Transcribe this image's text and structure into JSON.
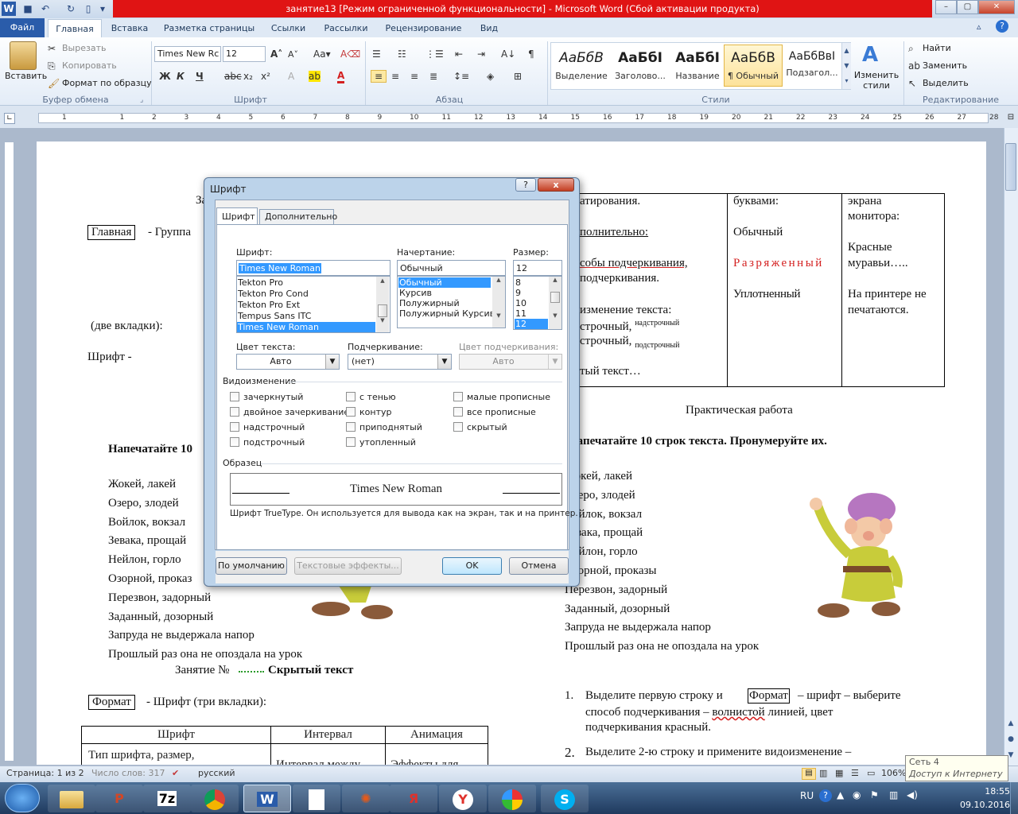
{
  "title": "занятие13 [Режим ограниченной функциональности]  -  Microsoft Word (Сбой активации продукта)",
  "tabs": [
    "Файл",
    "Главная",
    "Вставка",
    "Разметка страницы",
    "Ссылки",
    "Рассылки",
    "Рецензирование",
    "Вид"
  ],
  "clipboard": {
    "paste": "Вставить",
    "cut": "Вырезать",
    "copy": "Копировать",
    "format_painter": "Формат по образцу",
    "label": "Буфер обмена"
  },
  "font_group": {
    "font": "Times New Rc",
    "size": "12",
    "label": "Шрифт"
  },
  "paragraph_label": "Абзац",
  "styles": {
    "items": [
      {
        "sample": "АаБбВ",
        "name": "Выделение"
      },
      {
        "sample": "АаБбI",
        "name": "Заголово..."
      },
      {
        "sample": "АаБбI",
        "name": "Название"
      },
      {
        "sample": "АаБбВ",
        "name": "¶ Обычный"
      },
      {
        "sample": "АаБбВвI",
        "name": "Подзагол..."
      }
    ],
    "change": "Изменить стили",
    "label": "Стили"
  },
  "editing": {
    "find": "Найти",
    "replace": "Заменить",
    "select": "Выделить",
    "label": "Редактирование"
  },
  "ruler_nums": [
    "1",
    "1",
    "2",
    "3",
    "4",
    "5",
    "6",
    "7",
    "8",
    "9",
    "10",
    "11",
    "12",
    "13",
    "14",
    "15",
    "16",
    "17",
    "18",
    "19",
    "20",
    "21",
    "22",
    "23",
    "24",
    "25",
    "26",
    "27",
    "28"
  ],
  "doc": {
    "left_top": "За",
    "glavnaya": "Главная",
    "gruppa": "-  Группа",
    "dve_vkladki": "(две вкладки):",
    "shrift": "Шрифт   -",
    "napechataite_left": "Напечатайте  10",
    "left_lines": [
      "Жокей, лакей",
      "Озеро, злодей",
      "Войлок, вокзал",
      "Зевака, прощай",
      "Нейлон, горло",
      "Озорной, проказ",
      "Перезвон, задорный",
      "Заданный, дозорный",
      "Запруда не выдержала напор",
      "Прошлый раз она не опоздала на урок"
    ],
    "zanyatie": "Занятие №",
    "skryty": "Скрытый текст",
    "format": "Формат",
    "format_rest": "-  Шрифт (три вкладки):",
    "bottom_table": {
      "headers": [
        "Шрифт",
        "Интервал",
        "Анимация"
      ],
      "row1": [
        "Тип шрифта, размер,",
        "Интервал между",
        "Эффекты для"
      ]
    },
    "right_col1": [
      "атирования.",
      "полнительно:",
      "собы подчеркивания,",
      "подчеркивания.",
      "изменение текста:",
      "строчный,",
      "строчный,",
      "тый текст…"
    ],
    "nadstr": "надстрочный",
    "podstr": "подстрочный",
    "right_col2": [
      "буквами:",
      "Обычный",
      "Разряженный",
      "Уплотненный"
    ],
    "right_col3": [
      "экрана",
      "монитора:",
      "Красные",
      "муравьи…..",
      "На принтере не",
      "печатаются."
    ],
    "prakt": "Практическая работа",
    "napechataite_right": "Напечатайте  10 строк текста. Пронумеруйте их.",
    "right_lines": [
      "Жокей, лакей",
      "Озеро, злодей",
      "Войлок, вокзал",
      "Зевака, прощай",
      "Нейлон, горло",
      "Озорной, проказы",
      "Перезвон, задорный",
      "Заданный, дозорный",
      "Запруда не выдержала напор",
      "Прошлый раз она не опоздала на урок"
    ],
    "item1_a": "Выделите первую строку и",
    "item1_format": "Формат",
    "item1_b": "– шрифт – выберите",
    "item1_c": "способ подчеркивания –",
    "item1_wavy": "волнистой",
    "item1_d": "линией, цвет",
    "item1_e": "подчеркивания красный.",
    "item2": "Выделите 2-ю строку  и примените видоизменение –"
  },
  "dialog": {
    "title": "Шрифт",
    "help": "?",
    "close": "x",
    "tab_font": "Шрифт",
    "tab_adv": "Дополнительно",
    "font_label": "Шрифт:",
    "font_value": "Times New Roman",
    "font_list": [
      "Tekton Pro",
      "Tekton Pro Cond",
      "Tekton Pro Ext",
      "Tempus Sans ITC",
      "Times New Roman"
    ],
    "style_label": "Начертание:",
    "style_value": "Обычный",
    "style_list": [
      "Обычный",
      "Курсив",
      "Полужирный",
      "Полужирный Курсив"
    ],
    "size_label": "Размер:",
    "size_value": "12",
    "size_list": [
      "8",
      "9",
      "10",
      "11",
      "12"
    ],
    "color_label": "Цвет текста:",
    "color_value": "Авто",
    "underline_label": "Подчеркивание:",
    "underline_value": "(нет)",
    "ucolor_label": "Цвет подчеркивания:",
    "ucolor_value": "Авто",
    "effects_label": "Видоизменение",
    "effects": [
      "зачеркнутый",
      "двойное зачеркивание",
      "надстрочный",
      "подстрочный",
      "с тенью",
      "контур",
      "приподнятый",
      "утопленный",
      "малые прописные",
      "все прописные",
      "скрытый"
    ],
    "sample_label": "Образец",
    "sample_text": "Times New Roman",
    "truetype_note": "Шрифт TrueType. Он используется для вывода как на экран, так и на принтер.",
    "btn_default": "По умолчанию",
    "btn_effects": "Текстовые эффекты...",
    "btn_ok": "OK",
    "btn_cancel": "Отмена"
  },
  "status": {
    "page": "Страница: 1 из 2",
    "words": "Число слов: 317",
    "lang": "русский",
    "zoom": "106%",
    "network": "Сеть  4",
    "internet": "Доступ к Интернету"
  },
  "taskbar": {
    "lang": "RU",
    "time": "18:55",
    "date": "09.10.2016",
    "apps": [
      "7z",
      "W",
      "Я"
    ]
  }
}
